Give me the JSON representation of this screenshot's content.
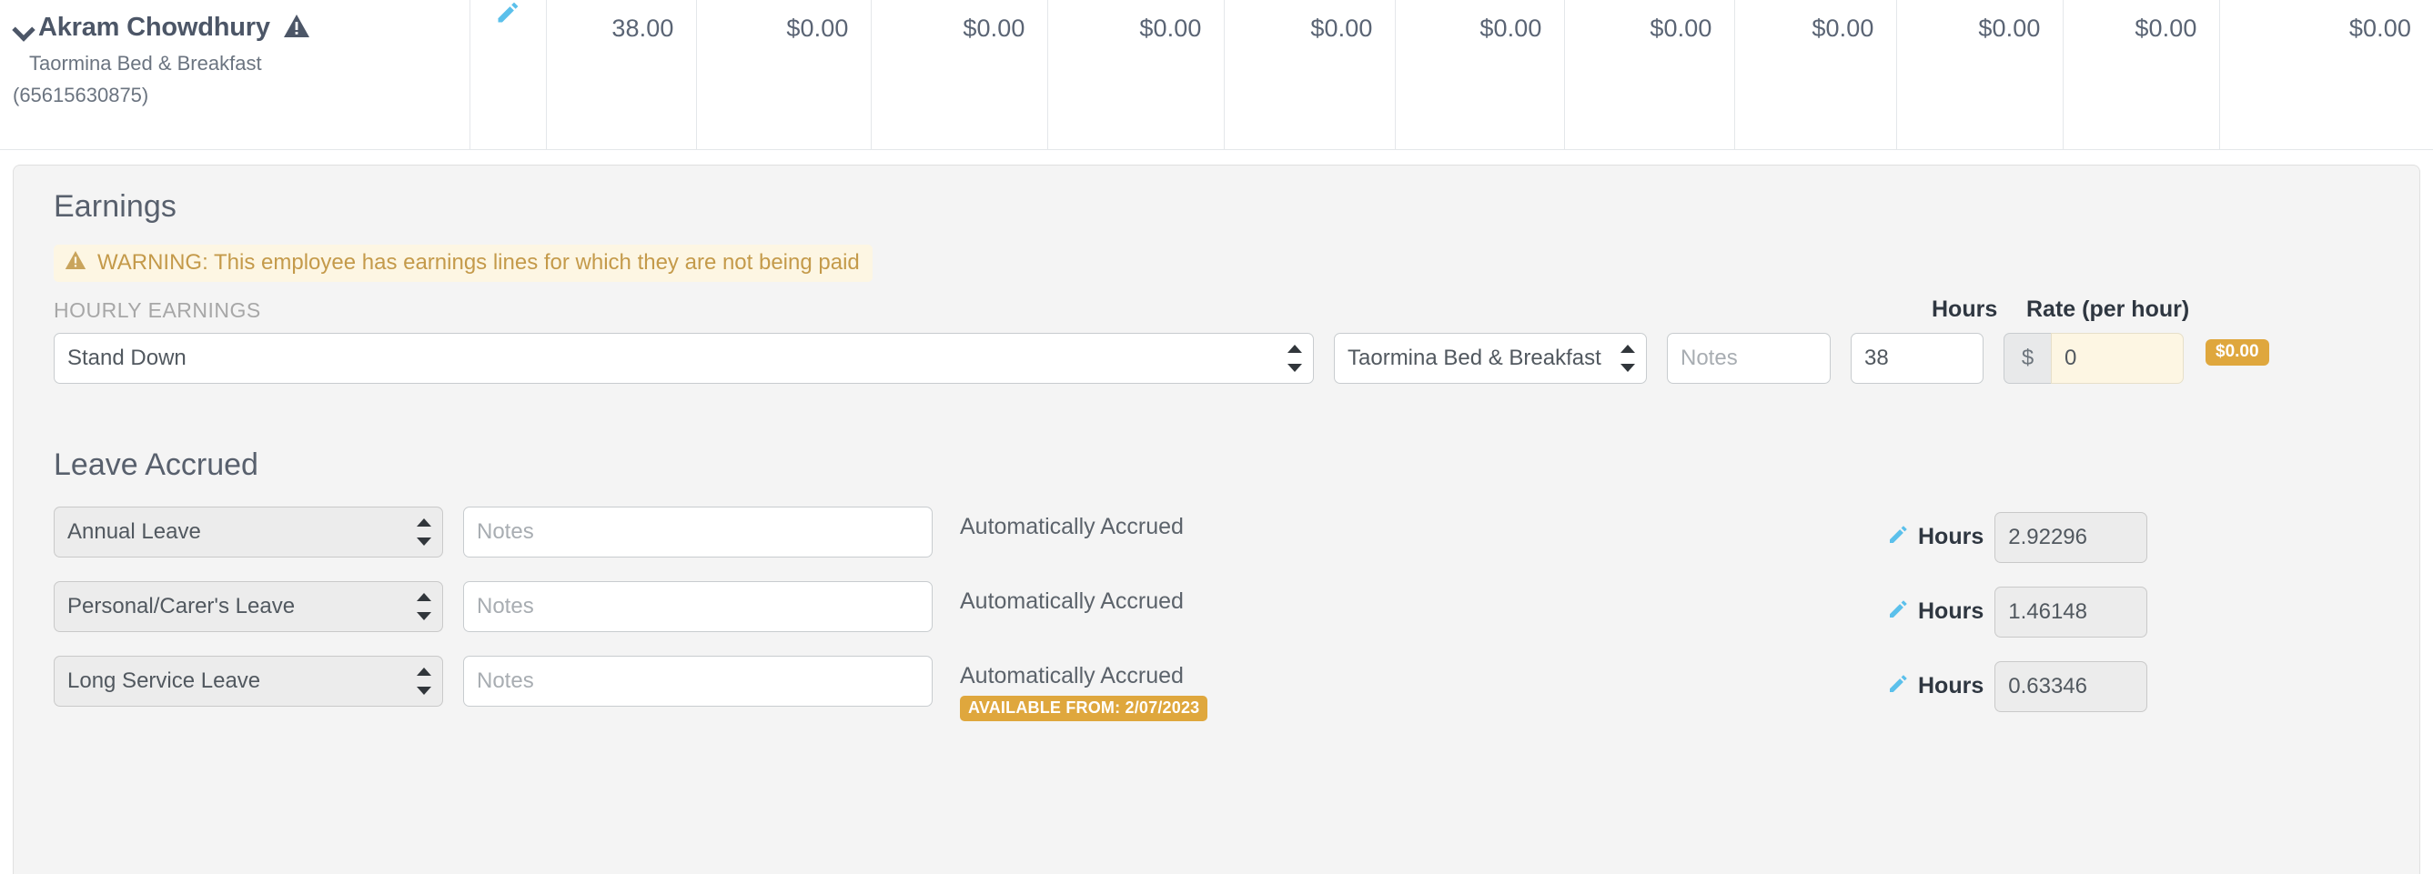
{
  "employee": {
    "name": "Akram Chowdhury",
    "location": "Taormina Bed & Breakfast",
    "id": "(65615630875)",
    "chevron_icon": "chevron-down-icon",
    "warning_icon": "warning-triangle-icon",
    "edit_icon": "pencil-edit-icon"
  },
  "summary_row": {
    "values": [
      "38.00",
      "$0.00",
      "$0.00",
      "$0.00",
      "$0.00",
      "$0.00",
      "$0.00",
      "$0.00",
      "$0.00",
      "$0.00",
      "$0.00"
    ]
  },
  "earnings": {
    "title": "Earnings",
    "warning": {
      "icon": "warning-triangle-icon",
      "text": "WARNING: This employee has earnings lines for which they are not being paid"
    },
    "group_label": "HOURLY EARNINGS",
    "headers": {
      "hours": "Hours",
      "rate": "Rate (per hour)"
    },
    "lines": [
      {
        "pay_category": "Stand Down",
        "location": "Taormina Bed & Breakfast",
        "notes_placeholder": "Notes",
        "notes_value": "",
        "hours": "38",
        "currency_symbol": "$",
        "rate": "0",
        "amount_badge": "$0.00"
      }
    ]
  },
  "leave_accrued": {
    "title": "Leave Accrued",
    "hours_label": "Hours",
    "edit_icon": "pencil-edit-icon",
    "rows": [
      {
        "leave_category": "Annual Leave",
        "notes_placeholder": "Notes",
        "notes_value": "",
        "accrual_text": "Automatically Accrued",
        "available_badge": "",
        "hours": "2.92296"
      },
      {
        "leave_category": "Personal/Carer's Leave",
        "notes_placeholder": "Notes",
        "notes_value": "",
        "accrual_text": "Automatically Accrued",
        "available_badge": "",
        "hours": "1.46148"
      },
      {
        "leave_category": "Long Service Leave",
        "notes_placeholder": "Notes",
        "notes_value": "",
        "accrual_text": "Automatically Accrued",
        "available_badge": "AVAILABLE FROM: 2/07/2023",
        "hours": "0.63346"
      }
    ]
  },
  "colors": {
    "warning_amber": "#c49a4a",
    "warning_bg": "#fdf6e3",
    "badge_amber": "#dfa73d",
    "accent_blue": "#5bc0eb",
    "text_dark": "#4c5667",
    "panel_bg": "#f4f4f4"
  }
}
